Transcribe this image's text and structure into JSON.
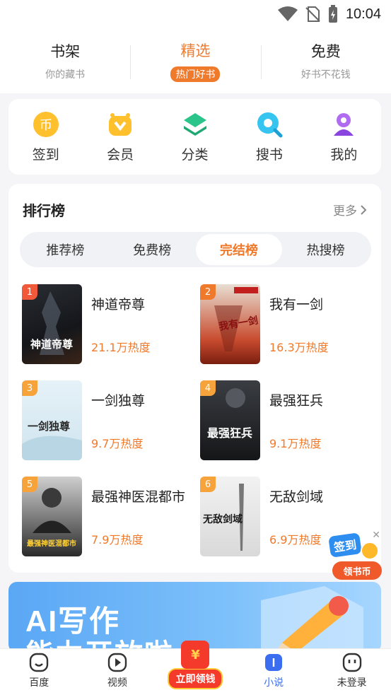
{
  "status_bar": {
    "time": "10:04"
  },
  "top_tabs": [
    {
      "title": "书架",
      "subtitle": "你的藏书"
    },
    {
      "title": "精选",
      "subtitle": "热门好书"
    },
    {
      "title": "免费",
      "subtitle": "好书不花钱"
    }
  ],
  "shortcuts": [
    {
      "label": "签到",
      "icon": "coin-icon"
    },
    {
      "label": "会员",
      "icon": "vip-crown-icon"
    },
    {
      "label": "分类",
      "icon": "layers-icon"
    },
    {
      "label": "搜书",
      "icon": "search-icon"
    },
    {
      "label": "我的",
      "icon": "user-icon"
    }
  ],
  "ranking": {
    "title": "排行榜",
    "more": "更多",
    "tabs": [
      "推荐榜",
      "免费榜",
      "完结榜",
      "热搜榜"
    ],
    "active_tab": "完结榜",
    "books": [
      {
        "rank": "1",
        "title": "神道帝尊",
        "heat": "21.1万热度",
        "cover_text": "神道帝尊"
      },
      {
        "rank": "2",
        "title": "我有一剑",
        "heat": "16.3万热度",
        "cover_text": "我有一剑"
      },
      {
        "rank": "3",
        "title": "一剑独尊",
        "heat": "9.7万热度",
        "cover_text": "一剑独尊"
      },
      {
        "rank": "4",
        "title": "最强狂兵",
        "heat": "9.1万热度",
        "cover_text": "最强狂兵"
      },
      {
        "rank": "5",
        "title": "最强神医混都市",
        "heat": "7.9万热度",
        "cover_text": "最强神医混都市"
      },
      {
        "rank": "6",
        "title": "无敌剑域",
        "heat": "6.9万热度",
        "cover_text": "无敌剑域"
      }
    ]
  },
  "banner": {
    "line1": "AI写作",
    "line2": "能力开放啦"
  },
  "floating_badge": {
    "sign": "签到",
    "label": "领书币"
  },
  "bottom_nav": [
    {
      "label": "百度",
      "icon": "baidu-face-icon"
    },
    {
      "label": "视频",
      "icon": "play-icon"
    },
    {
      "label": "立即领钱",
      "icon": "red-envelope-icon"
    },
    {
      "label": "小说",
      "icon": "book-icon"
    },
    {
      "label": "未登录",
      "icon": "robot-face-icon"
    }
  ],
  "colors": {
    "accent": "#f07a2c",
    "active_nav": "#3a6df0",
    "rank_red": "#f0593a",
    "rank_orange": "#f7a33b"
  }
}
